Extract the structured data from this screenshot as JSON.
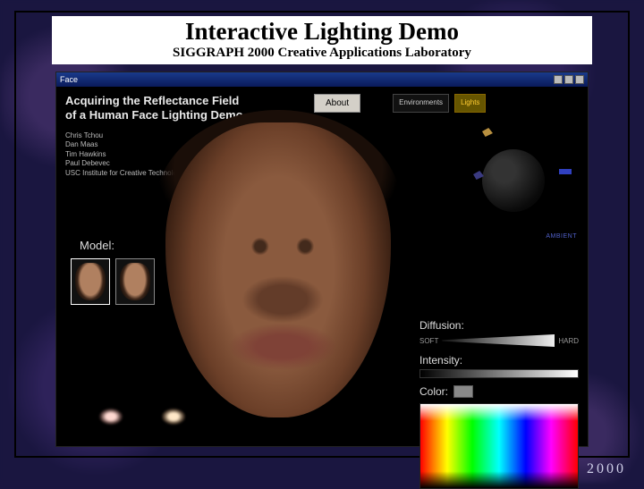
{
  "slide": {
    "title": "Interactive Lighting Demo",
    "subtitle": "SIGGRAPH 2000 Creative Applications Laboratory"
  },
  "window": {
    "title": "Face"
  },
  "header": {
    "line1": "Acquiring the Reflectance Field",
    "line2": "of a Human Face Lighting Demo"
  },
  "authors": [
    "Chris Tchou",
    "Dan Maas",
    "Tim Hawkins",
    "Paul Debevec",
    "USC Institute for Creative Technologies"
  ],
  "tabs": {
    "about": "About",
    "environments": "Environments",
    "lights": "Lights",
    "active": "about"
  },
  "model": {
    "label": "Model:"
  },
  "lights_panel": {
    "ambient": "AMBIENT",
    "diffusion_label": "Diffusion:",
    "diffusion_soft": "SOFT",
    "diffusion_hard": "HARD",
    "intensity_label": "Intensity:",
    "color_label": "Color:"
  },
  "footer": {
    "year": "2000"
  }
}
